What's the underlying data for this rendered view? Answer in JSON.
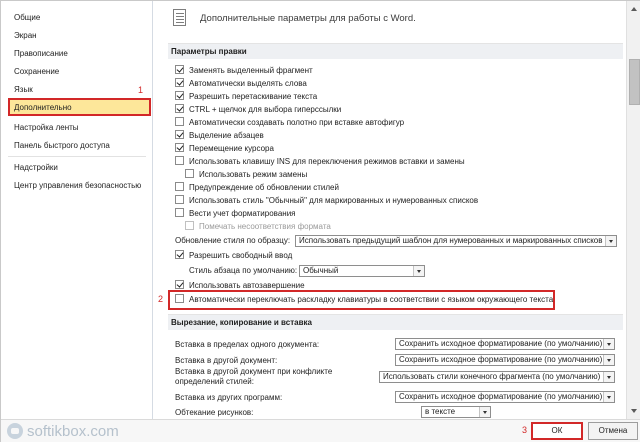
{
  "sidebar": {
    "items": [
      {
        "label": "Общие"
      },
      {
        "label": "Экран"
      },
      {
        "label": "Правописание"
      },
      {
        "label": "Сохранение"
      },
      {
        "label": "Язык"
      },
      {
        "label": "Дополнительно"
      },
      {
        "label": "Настройка ленты"
      },
      {
        "label": "Панель быстрого доступа"
      },
      {
        "label": "Надстройки"
      },
      {
        "label": "Центр управления безопасностью"
      }
    ],
    "callout": "1"
  },
  "main": {
    "title": "Дополнительные параметры для работы с Word.",
    "section_editing": "Параметры правки",
    "options": [
      {
        "label": "Заменять выделенный фрагмент",
        "checked": true
      },
      {
        "label": "Автоматически выделять слова",
        "checked": true
      },
      {
        "label": "Разрешить перетаскивание текста",
        "checked": true
      },
      {
        "label": "CTRL + щелчок для выбора гиперссылки",
        "checked": true
      },
      {
        "label": "Автоматически создавать полотно при вставке автофигур",
        "checked": false
      },
      {
        "label": "Выделение абзацев",
        "checked": true
      },
      {
        "label": "Перемещение курсора",
        "checked": true
      },
      {
        "label": "Использовать клавишу INS для переключения режимов вставки и замены",
        "checked": false
      },
      {
        "label": "Использовать режим замены",
        "checked": false
      },
      {
        "label": "Предупреждение об обновлении стилей",
        "checked": false
      },
      {
        "label": "Использовать стиль \"Обычный\" для маркированных и нумерованных списков",
        "checked": false
      },
      {
        "label": "Вести учет форматирования",
        "checked": false
      },
      {
        "label": "Помечать несоответствия формата",
        "checked": false
      }
    ],
    "style_update_label": "Обновление стиля по образцу:",
    "style_update_value": "Использовать предыдущий шаблон для нумерованных и маркированных списков",
    "click_type_label": "Разрешить свободный ввод",
    "click_type_checked": true,
    "para_style_label": "Стиль абзаца по умолчанию:",
    "para_style_value": "Обычный",
    "autocomplete_label": "Использовать автозавершение",
    "autocomplete_checked": true,
    "keyboard_label": "Автоматически переключать раскладку клавиатуры в соответствии с языком окружающего текста",
    "keyboard_checked": false,
    "callout": "2",
    "section_paste": "Вырезание, копирование и вставка",
    "paste_rows": [
      {
        "label": "Вставка в пределах одного документа:",
        "value": "Сохранить исходное форматирование (по умолчанию)"
      },
      {
        "label": "Вставка в другой документ:",
        "value": "Сохранить исходное форматирование (по умолчанию)"
      },
      {
        "label": "Вставка в другой документ при конфликте определений стилей:",
        "value": "Использовать стили конечного фрагмента (по умолчанию)"
      },
      {
        "label": "Вставка из других программ:",
        "value": "Сохранить исходное форматирование (по умолчанию)"
      },
      {
        "label": "Обтекание рисунков:",
        "value": "в тексте"
      }
    ]
  },
  "footer": {
    "ok": "ОК",
    "cancel": "Отмена",
    "callout": "3",
    "watermark": "softikbox.com"
  },
  "colors": {
    "highlight": "#d22828",
    "active_nav": "#fde79a",
    "section_bg": "#eef0f3"
  }
}
